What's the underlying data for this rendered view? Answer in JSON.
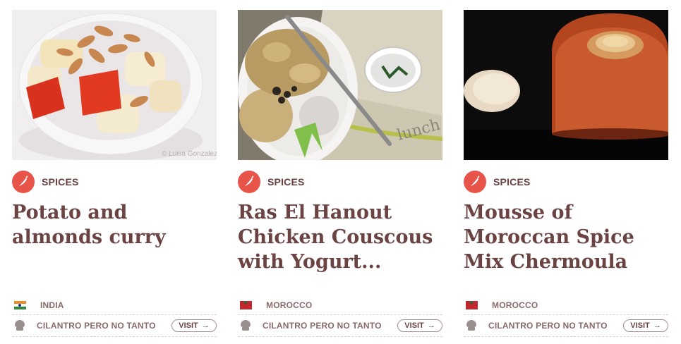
{
  "cards": [
    {
      "category": "SPICES",
      "title": "Potato and almonds curry",
      "country": "INDIA",
      "author": "CILANTRO PERO NO TANTO",
      "visit_label": "VISIT",
      "photo_credit": "© Luisa Gonzalez"
    },
    {
      "category": "SPICES",
      "title": "Ras El Hanout Chicken Couscous with Yogurt...",
      "country": "MOROCCO",
      "author": "CILANTRO PERO NO TANTO",
      "visit_label": "VISIT"
    },
    {
      "category": "SPICES",
      "title": "Mousse of Moroccan Spice Mix Chermoula",
      "country": "MOROCCO",
      "author": "CILANTRO PERO NO TANTO",
      "visit_label": "VISIT"
    }
  ],
  "icons": {
    "category": "chili-pepper-icon",
    "author": "chef-hat-icon",
    "visit": "arrow-right-icon"
  },
  "colors": {
    "accent": "#e8534a",
    "title": "#6b4343",
    "meta_text": "#8a6a6a"
  }
}
